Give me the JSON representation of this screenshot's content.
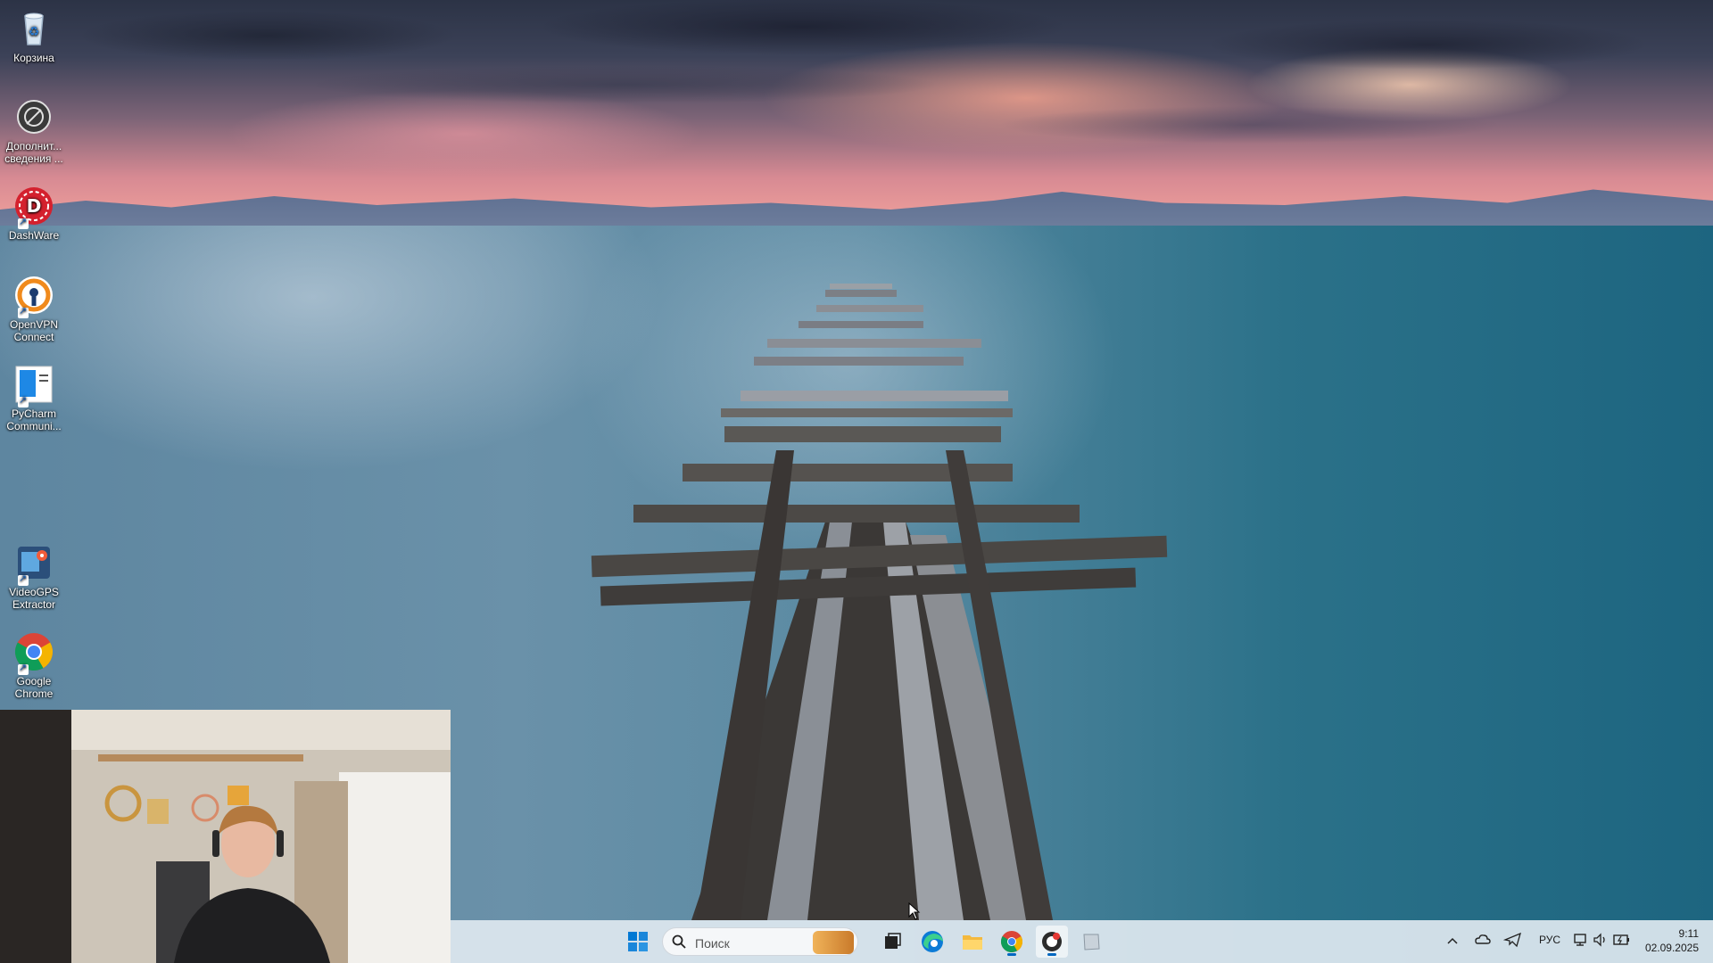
{
  "desktop": {
    "icons": [
      {
        "label": "Корзина",
        "icon": "recycle-bin-icon"
      },
      {
        "label": "Дополнит... сведения ...",
        "icon": "additional-info-icon"
      },
      {
        "label": "DashWare",
        "icon": "dashware-icon"
      },
      {
        "label": "OpenVPN Connect",
        "icon": "openvpn-icon"
      },
      {
        "label": "PyCharm Communi...",
        "icon": "pycharm-icon"
      },
      {
        "label": "VideoGPS Extractor",
        "icon": "videogps-icon"
      },
      {
        "label": "Google Chrome",
        "icon": "chrome-icon"
      }
    ]
  },
  "taskbar": {
    "search_placeholder": "Поиск",
    "apps": [
      "windows-start-icon",
      "search-icon",
      "task-view-icon",
      "edge-icon",
      "file-explorer-icon",
      "chrome-icon",
      "recording-app-icon",
      "notes-app-icon"
    ],
    "tray": {
      "language": "РУС",
      "time": "9:11",
      "date": "02.09.2025"
    }
  },
  "colors": {
    "taskbar_bg": "#dee8f0",
    "accent": "#0067c0"
  }
}
